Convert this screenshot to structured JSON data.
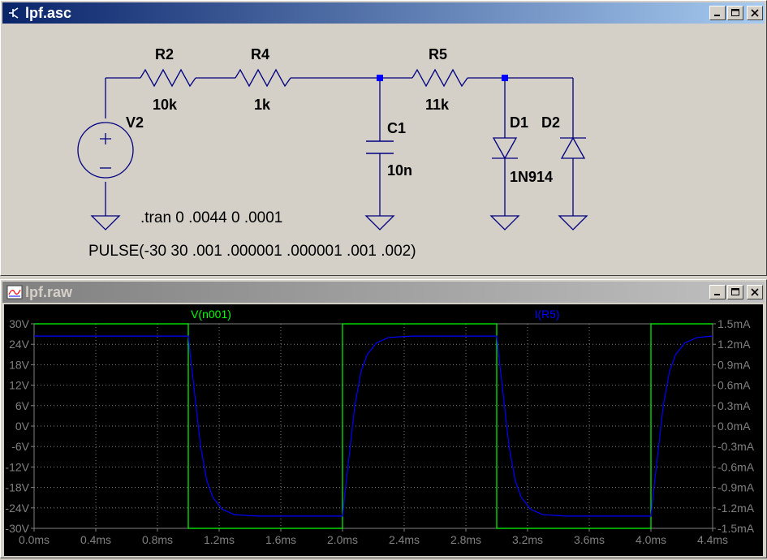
{
  "schematic_window": {
    "title": "lpf.asc",
    "components": {
      "r2_name": "R2",
      "r2_value": "10k",
      "r4_name": "R4",
      "r4_value": "1k",
      "r5_name": "R5",
      "r5_value": "11k",
      "c1_name": "C1",
      "c1_value": "10n",
      "v2_name": "V2",
      "d1_name": "D1",
      "d2_name": "D2",
      "diode_model": "1N914"
    },
    "directive": ".tran 0 .0044 0 .0001",
    "source_spec": "PULSE(-30 30 .001 .000001 .000001 .001 .002)"
  },
  "plot_window": {
    "title": "lpf.raw"
  },
  "chart_data": {
    "type": "line",
    "background": "#000000",
    "grid": true,
    "x_ticks": [
      "0.0ms",
      "0.4ms",
      "0.8ms",
      "1.2ms",
      "1.6ms",
      "2.0ms",
      "2.4ms",
      "2.8ms",
      "3.2ms",
      "3.6ms",
      "4.0ms",
      "4.4ms"
    ],
    "xlim": [
      0,
      4.4
    ],
    "y_left_ticks": [
      "30V",
      "24V",
      "18V",
      "12V",
      "6V",
      "0V",
      "-6V",
      "-12V",
      "-18V",
      "-24V",
      "-30V"
    ],
    "y_left_lim": [
      -30,
      30
    ],
    "y_right_ticks": [
      "1.5mA",
      "1.2mA",
      "0.9mA",
      "0.6mA",
      "0.3mA",
      "0.0mA",
      "-0.3mA",
      "-0.6mA",
      "-0.9mA",
      "-1.2mA",
      "-1.5mA"
    ],
    "y_right_lim": [
      -1.5,
      1.5
    ],
    "series": [
      {
        "name": "V(n001)",
        "color": "#00ff00",
        "axis": "left",
        "x": [
          0,
          1.0,
          1.0,
          2.0,
          2.0,
          3.0,
          3.0,
          4.0,
          4.0,
          4.4
        ],
        "y": [
          30,
          30,
          -30,
          -30,
          30,
          30,
          -30,
          -30,
          30,
          30
        ]
      },
      {
        "name": "I(R5)",
        "color": "#0000ff",
        "axis": "right",
        "x": [
          0,
          1.0,
          1.02,
          1.05,
          1.08,
          1.12,
          1.16,
          1.22,
          1.3,
          1.45,
          2.0,
          2.02,
          2.05,
          2.08,
          2.12,
          2.16,
          2.22,
          2.3,
          2.45,
          3.0,
          3.02,
          3.05,
          3.08,
          3.12,
          3.16,
          3.22,
          3.3,
          3.45,
          4.0,
          4.02,
          4.05,
          4.08,
          4.12,
          4.16,
          4.22,
          4.3,
          4.4
        ],
        "y": [
          1.32,
          1.32,
          0.9,
          0.3,
          -0.3,
          -0.8,
          -1.05,
          -1.22,
          -1.3,
          -1.32,
          -1.32,
          -0.9,
          -0.3,
          0.3,
          0.8,
          1.05,
          1.22,
          1.3,
          1.32,
          1.32,
          0.9,
          0.3,
          -0.3,
          -0.8,
          -1.05,
          -1.22,
          -1.3,
          -1.32,
          -1.32,
          -0.9,
          -0.3,
          0.3,
          0.8,
          1.05,
          1.22,
          1.3,
          1.32
        ]
      }
    ]
  }
}
